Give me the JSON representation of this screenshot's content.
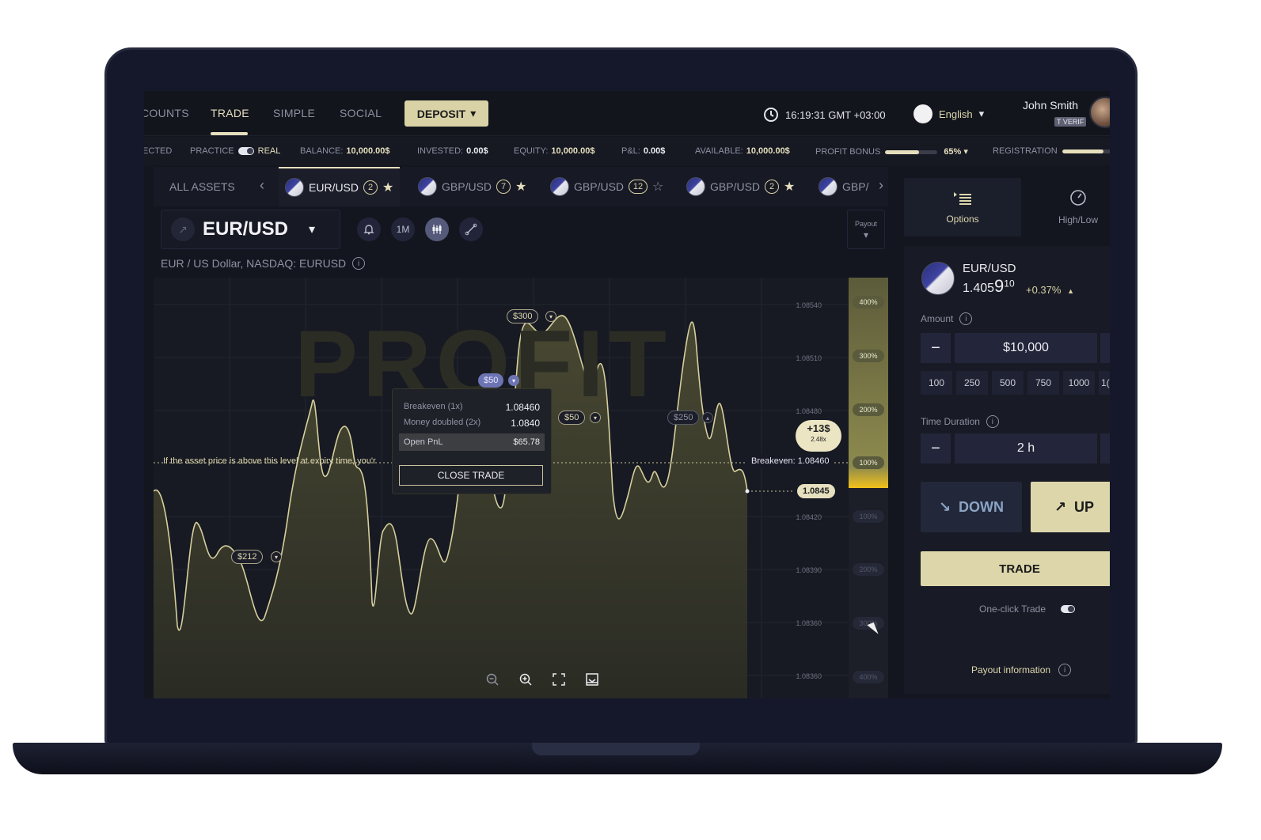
{
  "nav": {
    "items": [
      "COUNTS",
      "TRADE",
      "SIMPLE",
      "SOCIAL"
    ],
    "deposit": "DEPOSIT",
    "time": "16:19:31 GMT +03:00",
    "language": "English",
    "user_name": "John Smith",
    "verif_badge": "T VERIF"
  },
  "stats": {
    "cut_label": "ECTED",
    "practice": "PRACTICE",
    "real": "REAL",
    "balance_label": "BALANCE:",
    "balance": "10,000.00$",
    "invested_label": "INVESTED:",
    "invested": "0.00$",
    "equity_label": "EQUITY:",
    "equity": "10,000.00$",
    "pnl_label": "P&L:",
    "pnl": "0.00$",
    "available_label": "AVAILABLE:",
    "available": "10,000.00$",
    "profit_bonus_label": "PROFIT BONUS",
    "profit_bonus_pct": "65%",
    "profit_bonus_fraction": 0.65,
    "registration_label": "REGISTRATION",
    "registration_fraction": 0.85
  },
  "assets": {
    "all_label": "ALL ASSETS",
    "tabs": [
      {
        "name": "EUR/USD",
        "count": "2",
        "starred": true
      },
      {
        "name": "GBP/USD",
        "count": "7",
        "starred": true
      },
      {
        "name": "GBP/USD",
        "count": "12",
        "starred": false
      },
      {
        "name": "GBP/USD",
        "count": "2",
        "starred": true
      },
      {
        "name": "GBP/",
        "count": "",
        "starred": false
      }
    ]
  },
  "chart_header": {
    "pair": "EUR/USD",
    "timeframe": "1M",
    "payout": "Payout",
    "subtitle": "EUR / US Dollar, NASDAQ: EURUSD"
  },
  "chart": {
    "watermark": "PROFIT",
    "price_labels": [
      "1.08540",
      "1.08510",
      "1.08480",
      "1.08420",
      "1.08390",
      "1.08360",
      "1.08360"
    ],
    "pct_up": [
      "400%",
      "300%",
      "200%",
      "100%"
    ],
    "pct_down": [
      "100%",
      "200%",
      "300%",
      "400%"
    ],
    "tags": {
      "t300": "$300",
      "t50a": "$50",
      "t50b": "$50",
      "t250": "$250",
      "t212": "$212"
    },
    "expiry_msg": "If the asset price is above this level at expiry time, you'r",
    "breakeven_tag": "Breakeven: 1.08460",
    "current_price": "1.0845",
    "profit_amount": "+13$",
    "profit_mult": "2.48x",
    "popup": {
      "breakeven_label": "Breakeven (1x)",
      "breakeven_value": "1.08460",
      "doubled_label": "Money doubled (2x)",
      "doubled_value": "1.0840",
      "pnl_label": "Open PnL",
      "pnl_value": "$65.78",
      "close_btn": "CLOSE TRADE"
    }
  },
  "panel": {
    "tab_options": "Options",
    "tab_highlow": "High/Low",
    "pair": "EUR/USD",
    "price_main": "1.405",
    "price_big": "9",
    "price_sup": "10",
    "change": "+0.37%",
    "amount_label": "Amount",
    "amount": "$10,000",
    "presets": [
      "100",
      "250",
      "500",
      "750",
      "1000",
      "1("
    ],
    "duration_label": "Time Duration",
    "duration": "2 h",
    "down": "DOWN",
    "up": "UP",
    "trade": "TRADE",
    "one_click": "One-click Trade",
    "payout_info": "Payout information"
  },
  "colors": {
    "accent": "#e6dfbd",
    "background": "#14161f",
    "line": "#d6cf9d"
  }
}
